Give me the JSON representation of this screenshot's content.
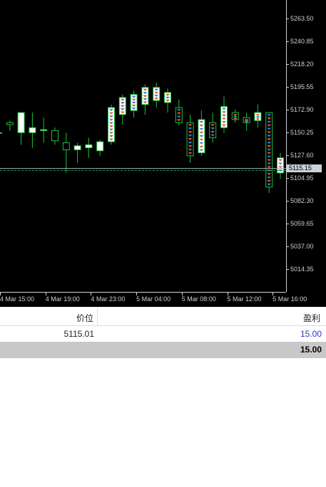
{
  "chart": {
    "background": "#000000",
    "bull_color": "#ffffff",
    "bear_color": "#000000",
    "wick_color": "#18c23a",
    "trade_buy_color": "#3a7fd5",
    "trade_sell_color": "#e25a2b",
    "y_axis_labels": [
      "5263.50",
      "5240.85",
      "5218.20",
      "5195.55",
      "5172.90",
      "5150.25",
      "5127.60",
      "5104.95",
      "5082.30",
      "5059.65",
      "5037.00",
      "5014.35"
    ],
    "x_axis_labels": [
      "4 Mar 15:00",
      "4 Mar 19:00",
      "4 Mar 23:00",
      "5 Mar 04:00",
      "5 Mar 08:00",
      "5 Mar 12:00",
      "5 Mar 16:00"
    ],
    "current_price_tag": "5115.15"
  },
  "chart_data": {
    "type": "candlestick",
    "ylim": [
      5000,
      5278
    ],
    "series": [
      {
        "name": "",
        "candles": [
          {
            "o": 5150,
            "h": 5200,
            "l": 5148,
            "c": 5150
          },
          {
            "o": 5160,
            "h": 5162,
            "l": 5152,
            "c": 5158
          },
          {
            "o": 5150,
            "h": 5168,
            "l": 5138,
            "c": 5170
          },
          {
            "o": 5150,
            "h": 5170,
            "l": 5135,
            "c": 5155
          },
          {
            "o": 5152,
            "h": 5165,
            "l": 5140,
            "c": 5153
          },
          {
            "o": 5152,
            "h": 5155,
            "l": 5138,
            "c": 5142
          },
          {
            "o": 5140,
            "h": 5150,
            "l": 5110,
            "c": 5133
          },
          {
            "o": 5133,
            "h": 5140,
            "l": 5120,
            "c": 5137
          },
          {
            "o": 5135,
            "h": 5145,
            "l": 5125,
            "c": 5138
          },
          {
            "o": 5132,
            "h": 5143,
            "l": 5127,
            "c": 5141
          },
          {
            "o": 5141,
            "h": 5178,
            "l": 5138,
            "c": 5175
          },
          {
            "o": 5168,
            "h": 5188,
            "l": 5158,
            "c": 5185
          },
          {
            "o": 5172,
            "h": 5192,
            "l": 5165,
            "c": 5188
          },
          {
            "o": 5178,
            "h": 5198,
            "l": 5168,
            "c": 5195
          },
          {
            "o": 5182,
            "h": 5200,
            "l": 5175,
            "c": 5195
          },
          {
            "o": 5180,
            "h": 5194,
            "l": 5170,
            "c": 5190
          },
          {
            "o": 5175,
            "h": 5183,
            "l": 5157,
            "c": 5160
          },
          {
            "o": 5160,
            "h": 5168,
            "l": 5120,
            "c": 5127
          },
          {
            "o": 5130,
            "h": 5172,
            "l": 5127,
            "c": 5163
          },
          {
            "o": 5160,
            "h": 5170,
            "l": 5140,
            "c": 5145
          },
          {
            "o": 5155,
            "h": 5186,
            "l": 5150,
            "c": 5176
          },
          {
            "o": 5170,
            "h": 5173,
            "l": 5160,
            "c": 5163
          },
          {
            "o": 5165,
            "h": 5170,
            "l": 5152,
            "c": 5160
          },
          {
            "o": 5162,
            "h": 5178,
            "l": 5155,
            "c": 5170
          },
          {
            "o": 5170,
            "h": 5165,
            "l": 5090,
            "c": 5096
          },
          {
            "o": 5110,
            "h": 5130,
            "l": 5104,
            "c": 5125
          }
        ]
      }
    ]
  },
  "table": {
    "headers": {
      "price": "价位",
      "profit": "盈利"
    },
    "rows": [
      {
        "price": "5115.01",
        "profit": "15.00"
      }
    ],
    "total_profit": "15.00",
    "profit_color": "#2b36c8"
  }
}
